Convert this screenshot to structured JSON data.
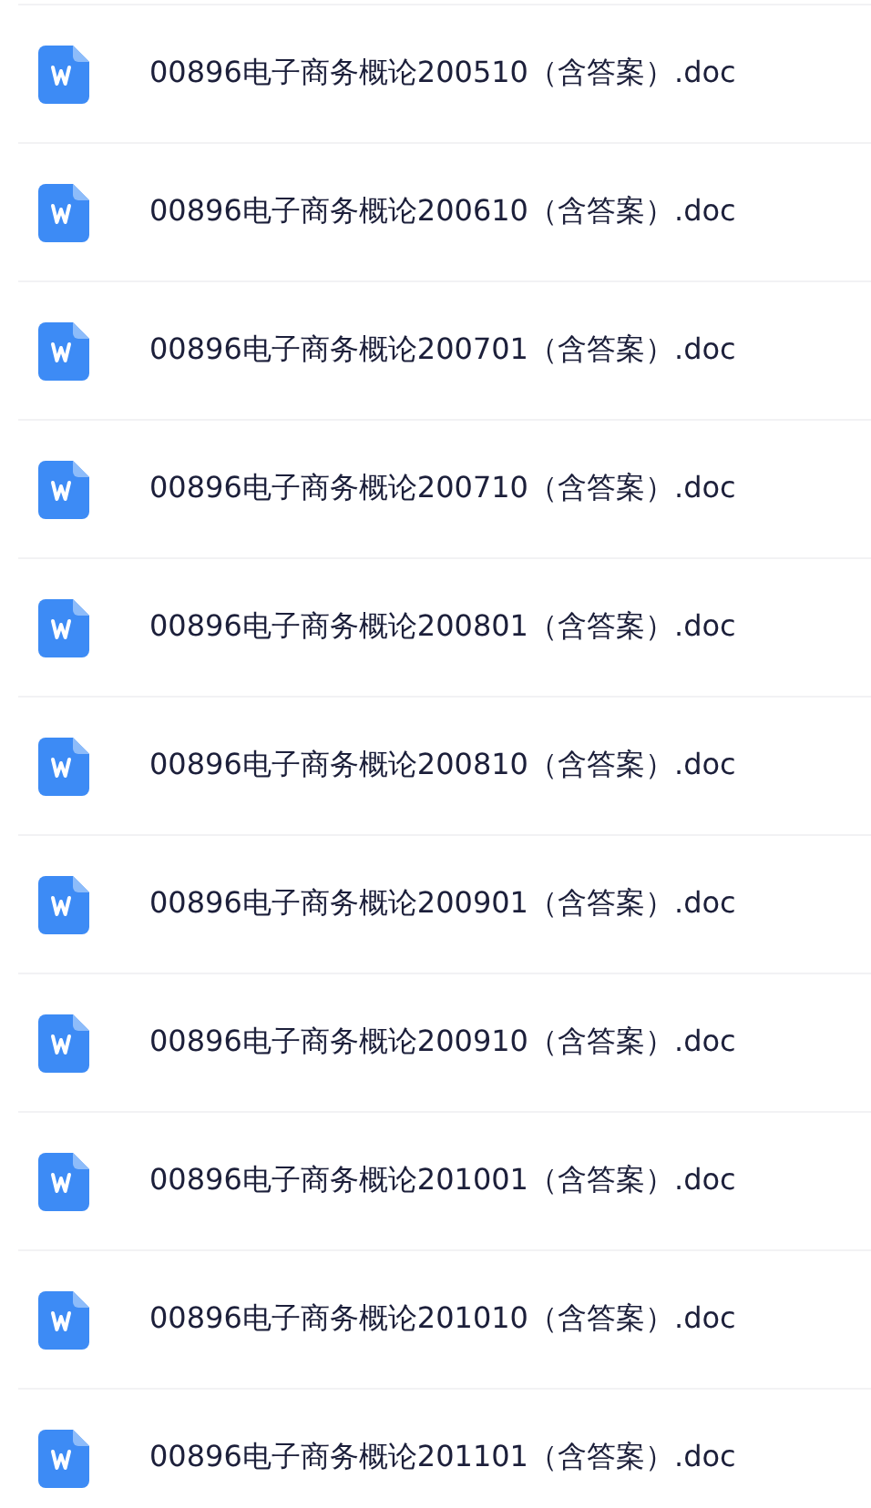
{
  "files": [
    {
      "name": "00896电子商务概论200510（含答案）.doc"
    },
    {
      "name": "00896电子商务概论200610（含答案）.doc"
    },
    {
      "name": "00896电子商务概论200701（含答案）.doc"
    },
    {
      "name": "00896电子商务概论200710（含答案）.doc"
    },
    {
      "name": "00896电子商务概论200801（含答案）.doc"
    },
    {
      "name": "00896电子商务概论200810（含答案）.doc"
    },
    {
      "name": "00896电子商务概论200901（含答案）.doc"
    },
    {
      "name": "00896电子商务概论200910（含答案）.doc"
    },
    {
      "name": "00896电子商务概论201001（含答案）.doc"
    },
    {
      "name": "00896电子商务概论201010（含答案）.doc"
    },
    {
      "name": "00896电子商务概论201101（含答案）.doc"
    }
  ]
}
